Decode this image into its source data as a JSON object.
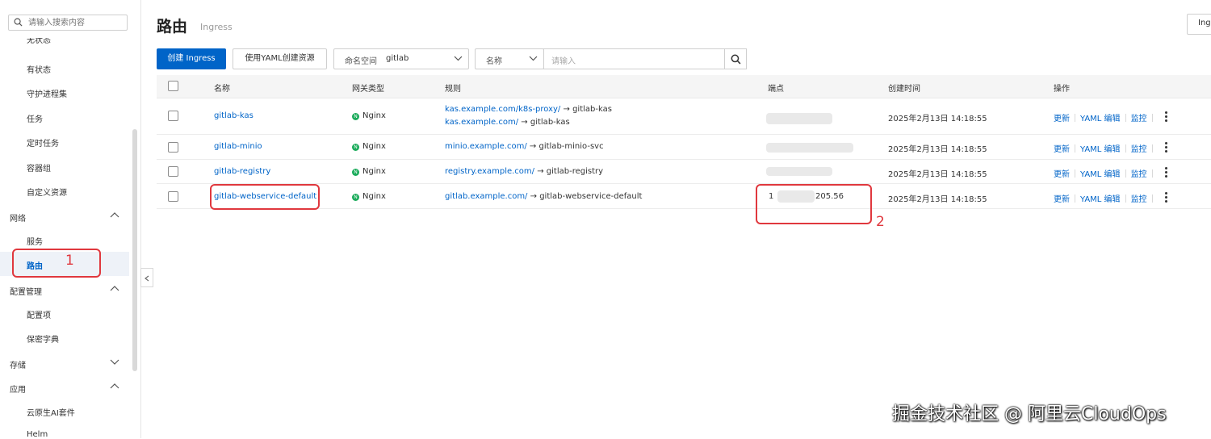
{
  "sidebar": {
    "search_placeholder": "请输入搜索内容",
    "items": [
      {
        "label": "无状态"
      },
      {
        "label": "有状态"
      },
      {
        "label": "守护进程集"
      },
      {
        "label": "任务"
      },
      {
        "label": "定时任务"
      },
      {
        "label": "容器组"
      },
      {
        "label": "自定义资源"
      }
    ],
    "group_network": "网络",
    "network_items": [
      {
        "label": "服务"
      },
      {
        "label": "路由"
      }
    ],
    "group_config": "配置管理",
    "config_items": [
      {
        "label": "配置项"
      },
      {
        "label": "保密字典"
      }
    ],
    "group_storage": "存储",
    "group_apps": "应用",
    "apps_items": [
      {
        "label": "云原生AI套件"
      },
      {
        "label": "Helm"
      }
    ]
  },
  "header": {
    "title": "路由",
    "subtitle": "Ingress",
    "top_right_button": "Ingress"
  },
  "toolbar": {
    "create_label": "创建 Ingress",
    "yaml_create_label": "使用YAML创建资源",
    "namespace_label": "命名空间",
    "namespace_value": "gitlab",
    "filter_label": "名称",
    "search_placeholder": "请输入"
  },
  "table": {
    "columns": [
      "名称",
      "网关类型",
      "规则",
      "端点",
      "创建时间",
      "操作"
    ],
    "rows": [
      {
        "name": "gitlab-kas",
        "gateway": "Nginx",
        "rules": [
          {
            "host": "kas.example.com/k8s-proxy/",
            "arrow": "→",
            "target": "gitlab-kas"
          },
          {
            "host": "kas.example.com/",
            "arrow": "→",
            "target": "gitlab-kas"
          }
        ],
        "endpoint": "",
        "created": "2025年2月13日 14:18:55"
      },
      {
        "name": "gitlab-minio",
        "gateway": "Nginx",
        "rules": [
          {
            "host": "minio.example.com/",
            "arrow": "→",
            "target": "gitlab-minio-svc"
          }
        ],
        "endpoint": "",
        "created": "2025年2月13日 14:18:55"
      },
      {
        "name": "gitlab-registry",
        "gateway": "Nginx",
        "rules": [
          {
            "host": "registry.example.com/",
            "arrow": "→",
            "target": "gitlab-registry"
          }
        ],
        "endpoint": "",
        "created": "2025年2月13日 14:18:55"
      },
      {
        "name": "gitlab-webservice-default",
        "gateway": "Nginx",
        "rules": [
          {
            "host": "gitlab.example.com/",
            "arrow": "→",
            "target": "gitlab-webservice-default"
          }
        ],
        "endpoint_prefix": "1",
        "endpoint_suffix": "205.56",
        "created": "2025年2月13日 14:18:55"
      }
    ],
    "ops": {
      "update": "更新",
      "yaml_edit": "YAML 编辑",
      "monitor": "监控"
    }
  },
  "annotations": {
    "one": "1",
    "two": "2"
  },
  "watermark": "掘金技术社区 @ 阿里云CloudOps",
  "colors": {
    "primary": "#0064c8",
    "annotation": "#e0383e",
    "nginx": "#1aab5a"
  }
}
